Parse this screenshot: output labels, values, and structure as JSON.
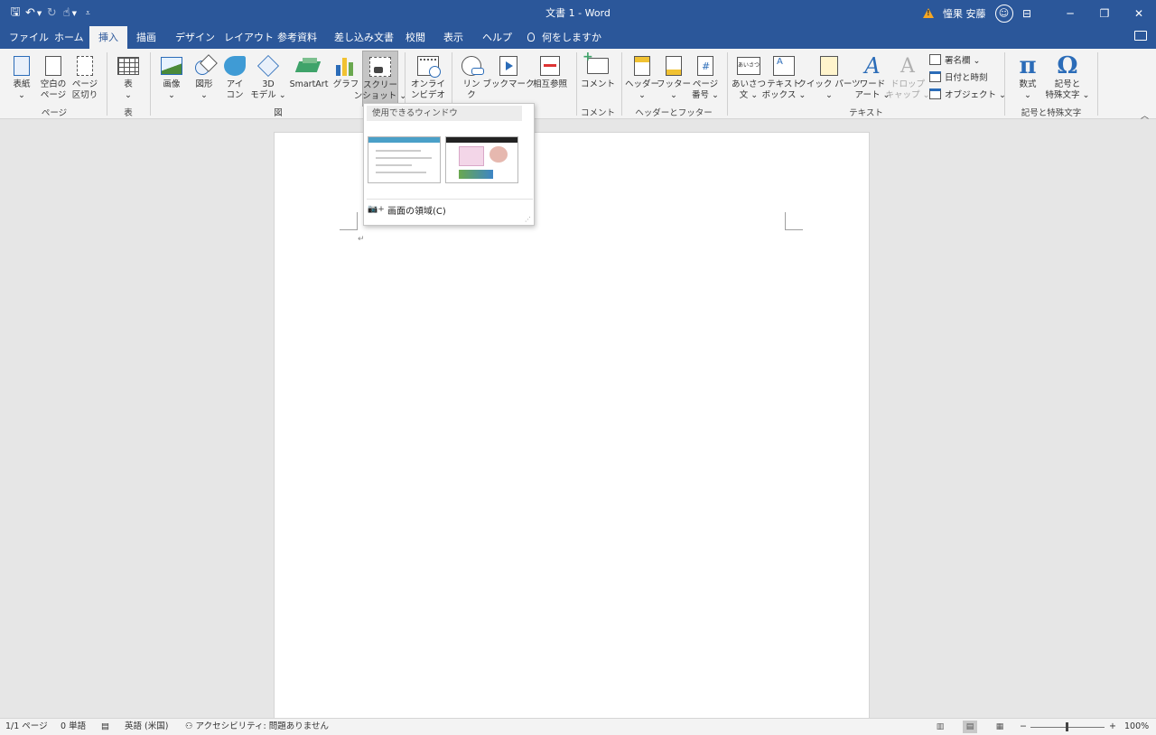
{
  "titlebar": {
    "title": "文書 1  -  Word",
    "user_name": "憧果 安藤",
    "qat": {
      "save": "🖫",
      "undo": "↶",
      "redo": "↻",
      "touch": "☝",
      "customize": "⩡"
    }
  },
  "tabs": [
    "ファイル",
    "ホーム",
    "挿入",
    "描画",
    "デザイン",
    "レイアウト",
    "参考資料",
    "差し込み文書",
    "校閲",
    "表示",
    "ヘルプ",
    "何をしますか"
  ],
  "ribbon": {
    "buttons": {
      "cover": [
        "表紙",
        "⌄"
      ],
      "blank": [
        "空白の",
        "ページ"
      ],
      "pagebreak": [
        "ページ",
        "区切り"
      ],
      "table": [
        "表",
        "⌄"
      ],
      "picture": [
        "画像",
        "⌄"
      ],
      "shapes": [
        "図形",
        "⌄"
      ],
      "icons": [
        "アイ",
        "コン"
      ],
      "model3d": [
        "3D",
        "モデル ⌄"
      ],
      "smartart": [
        "SmartArt"
      ],
      "chart": [
        "グラフ"
      ],
      "screenshot": [
        "スクリー",
        "ンショット ⌄"
      ],
      "onlinevideo": [
        "オンライ",
        "ンビデオ"
      ],
      "link": [
        "リン",
        "ク"
      ],
      "bookmark": [
        "ブックマーク"
      ],
      "crossref": [
        "相互参照"
      ],
      "comment": [
        "コメント"
      ],
      "header": [
        "ヘッダー",
        "⌄"
      ],
      "footer": [
        "フッター",
        "⌄"
      ],
      "pagenum": [
        "ページ",
        "番号 ⌄"
      ],
      "greeting": [
        "あいさつ",
        "文 ⌄"
      ],
      "textbox": [
        "テキスト",
        "ボックス ⌄"
      ],
      "quickparts": [
        "クイック パーツ",
        "⌄"
      ],
      "wordart": [
        "ワード",
        "アート ⌄"
      ],
      "dropcap": [
        "ドロップ",
        "キャップ ⌄"
      ],
      "equation": [
        "数式",
        "⌄"
      ],
      "symbol": [
        "記号と",
        "特殊文字 ⌄"
      ]
    },
    "small": {
      "signature": "署名欄  ⌄",
      "datetime": "日付と時刻",
      "object": "オブジェクト  ⌄"
    },
    "icon_glyphs": {
      "greeting": "あいさつ",
      "wordart": "A",
      "dropcap": "A",
      "pi": "π",
      "omega": "Ω"
    },
    "groups": {
      "pages": "ページ",
      "tables": "表",
      "illustrations": "図",
      "comments": "コメント",
      "headerfooter": "ヘッダーとフッター",
      "text": "テキスト",
      "symbols": "記号と特殊文字"
    }
  },
  "screenshot_menu": {
    "header": "使用できるウィンドウ",
    "clip_label": "画面の領域(C)"
  },
  "document": {
    "para_mark": "↵"
  },
  "statusbar": {
    "page": "1/1 ページ",
    "words": "0 単語",
    "language": "英語 (米国)",
    "accessibility": "アクセシビリティ: 問題ありません",
    "zoom_minus": "−",
    "zoom_plus": "+",
    "zoom": "100%",
    "zoom_level_percent": 100
  },
  "colors": {
    "accent": "#2b579a",
    "ribbon": "#f3f3f3",
    "canvas": "#e6e6e6"
  }
}
